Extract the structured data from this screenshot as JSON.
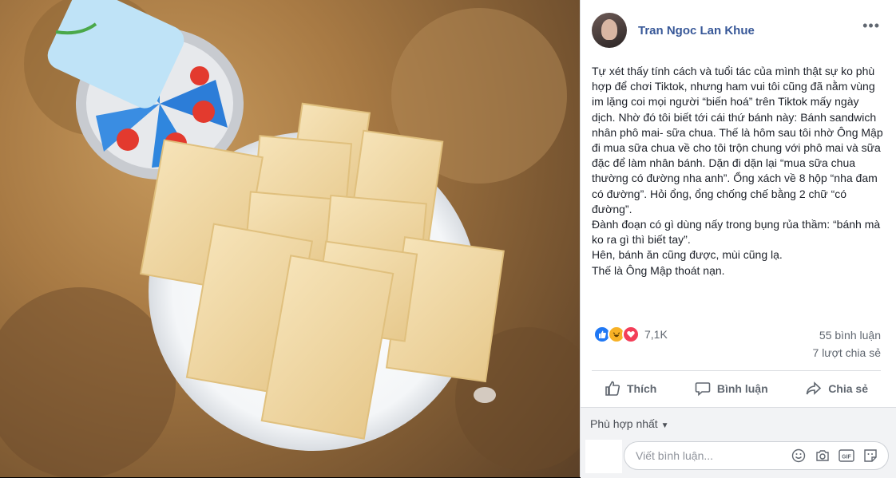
{
  "post": {
    "author": "Tran Ngoc Lan Khue",
    "more": "•••",
    "text": "Tự xét thấy tính cách và tuổi tác của mình thật sự ko phù hợp để chơi Tiktok, nhưng ham vui tôi cũng đã nằm vùng im lặng coi mọi người “biến hoá” trên Tiktok mấy ngày dịch. Nhờ đó tôi biết tới cái thứ bánh này: Bánh sandwich nhân phô mai- sữa chua. Thế là hôm sau tôi nhờ Ông Mập đi mua sữa chua về cho tôi trộn chung với phô mai và sữa đặc để làm nhân bánh. Dặn đi dặn lại “mua sữa chua thường có đường nha anh”. Ổng xách về 8 hộp “nha đam có đường”. Hỏi ổng, ổng chống chế bằng 2 chữ “có đường”.\nĐành đoạn có gì dùng nấy trong bụng rủa thầm: “bánh mà ko ra gì thì biết tay”.\nHên, bánh ăn cũng được, mùi cũng lạ.\nThế là Ông Mập thoát nạn."
  },
  "stats": {
    "reactions_count": "7,1K",
    "comments": "55 bình luận",
    "shares": "7 lượt chia sẻ",
    "reaction_icons": [
      "like-icon",
      "haha-icon",
      "love-icon"
    ]
  },
  "actions": {
    "like": "Thích",
    "comment": "Bình luận",
    "share": "Chia sẻ"
  },
  "comments": {
    "sort_label": "Phù hợp nhất",
    "input_placeholder": "Viết bình luận...",
    "input_icons": [
      "emoji-icon",
      "camera-icon",
      "gif-icon",
      "sticker-icon"
    ]
  },
  "colors": {
    "author": "#385898",
    "like_blue": "#2078f4",
    "haha_yellow": "#f7b125",
    "love_red": "#f33e58"
  }
}
